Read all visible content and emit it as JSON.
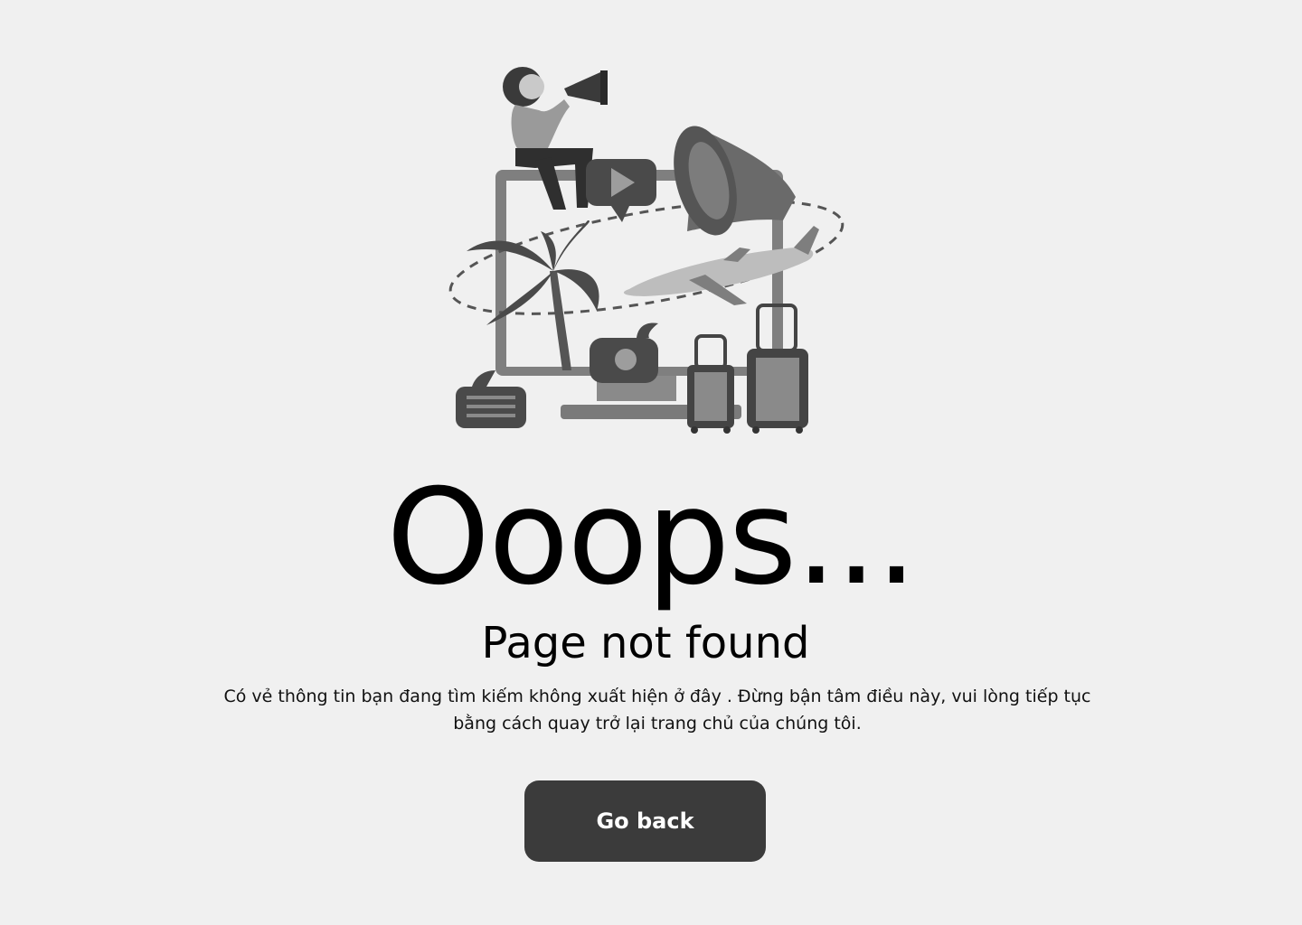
{
  "illustration": {
    "description_icons": [
      "woman-with-megaphone-icon",
      "monitor-icon",
      "play-bubble-icon",
      "megaphone-icon",
      "airplane-icon",
      "palm-tree-icon",
      "lightbulb-bubble-icon",
      "chat-bubble-icon",
      "suitcase-icon"
    ]
  },
  "error": {
    "headline": "Ooops...",
    "subtitle": "Page not found",
    "message": "Có vẻ thông tin bạn đang tìm kiếm không xuất hiện ở đây . Đừng bận tâm điều này, vui lòng tiếp tục\nbằng cách quay  trở lại trang chủ của chúng tôi."
  },
  "actions": {
    "go_back_label": "Go back"
  },
  "colors": {
    "background": "#f0f0f0",
    "button": "#3b3b3b",
    "button_text": "#ffffff"
  }
}
